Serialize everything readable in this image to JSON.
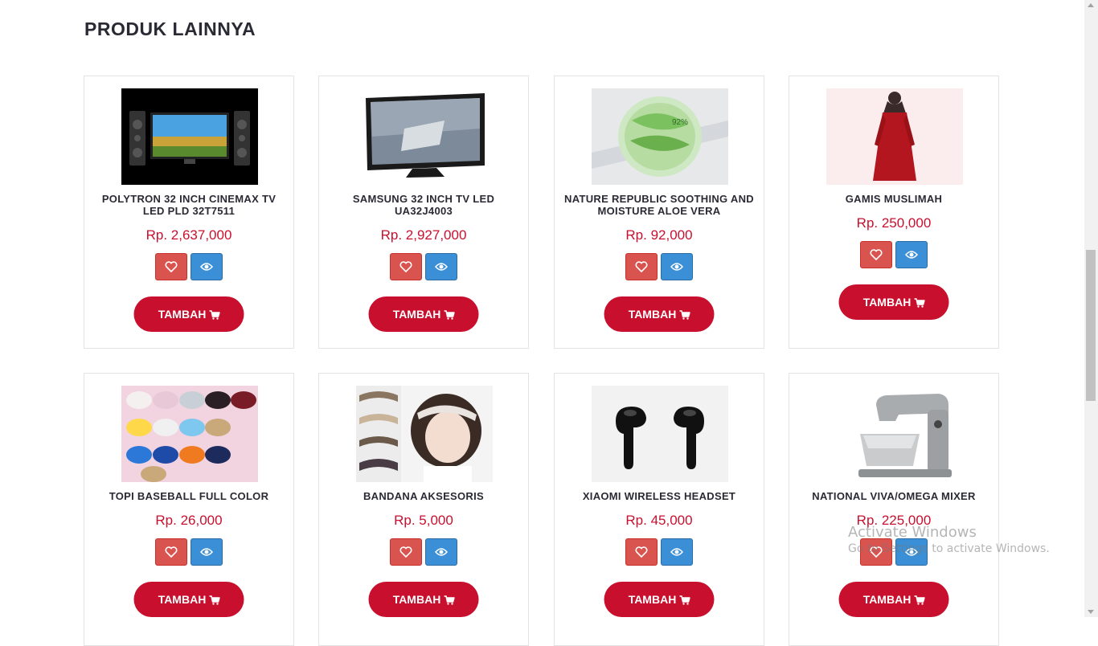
{
  "section_title": "PRODUK LAINNYA",
  "colors": {
    "accent": "#c8102e",
    "wishlist": "#d9534f",
    "view": "#3b8fd6"
  },
  "products": [
    {
      "name": "POLYTRON 32 INCH CINEMAX TV LED PLD 32T7511",
      "price": "Rp. 2,637,000",
      "button": "TAMBAH",
      "icon": "product-tv-speakers"
    },
    {
      "name": "SAMSUNG 32 INCH TV LED UA32J4003",
      "price": "Rp. 2,927,000",
      "button": "TAMBAH",
      "icon": "product-tv"
    },
    {
      "name": "NATURE REPUBLIC SOOTHING AND MOISTURE ALOE VERA",
      "price": "Rp. 92,000",
      "button": "TAMBAH",
      "icon": "product-aloe-jar"
    },
    {
      "name": "GAMIS MUSLIMAH",
      "price": "Rp. 250,000",
      "button": "TAMBAH",
      "icon": "product-dress"
    },
    {
      "name": "TOPI BASEBALL FULL COLOR",
      "price": "Rp. 26,000",
      "button": "TAMBAH",
      "icon": "product-caps"
    },
    {
      "name": "BANDANA AKSESORIS",
      "price": "Rp. 5,000",
      "button": "TAMBAH",
      "icon": "product-bandana"
    },
    {
      "name": "XIAOMI WIRELESS HEADSET",
      "price": "Rp. 45,000",
      "button": "TAMBAH",
      "icon": "product-earbuds"
    },
    {
      "name": "NATIONAL VIVA/OMEGA MIXER",
      "price": "Rp. 225,000",
      "button": "TAMBAH",
      "icon": "product-mixer"
    }
  ],
  "watermark": {
    "line1": "Activate Windows",
    "line2": "Go to Settings to activate Windows."
  }
}
